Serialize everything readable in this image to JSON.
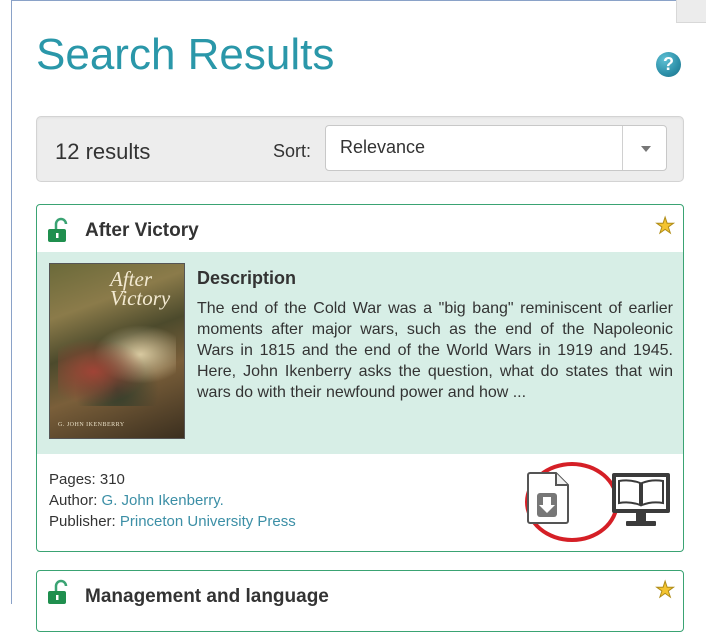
{
  "page": {
    "title": "Search Results",
    "help_icon": "question-circle-icon",
    "help_glyph": "?"
  },
  "results_bar": {
    "count_text": "12 results",
    "sort_label": "Sort:",
    "sort_value": "Relevance"
  },
  "results": [
    {
      "title": "After Victory",
      "access": "open-lock-icon",
      "favorite": "star-icon",
      "cover": {
        "title_line1": "After",
        "title_line2": "Victory",
        "author": "G. JOHN IKENBERRY"
      },
      "description_heading": "Description",
      "description": "The end of the Cold War was a \"big bang\" reminiscent of earlier moments after major wars, such as the end of the Napoleonic Wars in 1815 and the end of the World Wars in 1919 and 1945. Here, John Ikenberry asks the question, what do states that win wars do with their newfound power and how ...",
      "pages_label": "Pages:",
      "pages_value": "310",
      "author_label": "Author:",
      "author_value": "G. John Ikenberry.",
      "publisher_label": "Publisher:",
      "publisher_value": "Princeton University Press",
      "actions": [
        "download-icon",
        "online-reader-icon"
      ]
    },
    {
      "title": "Management and language",
      "access": "open-lock-icon",
      "favorite": "star-icon"
    }
  ],
  "colors": {
    "accent": "#2a97a9",
    "card_border": "#3aa373",
    "description_background": "#d7eee6",
    "link": "#3c8fa6",
    "highlight": "#d51f26",
    "star": "#f4c430"
  }
}
